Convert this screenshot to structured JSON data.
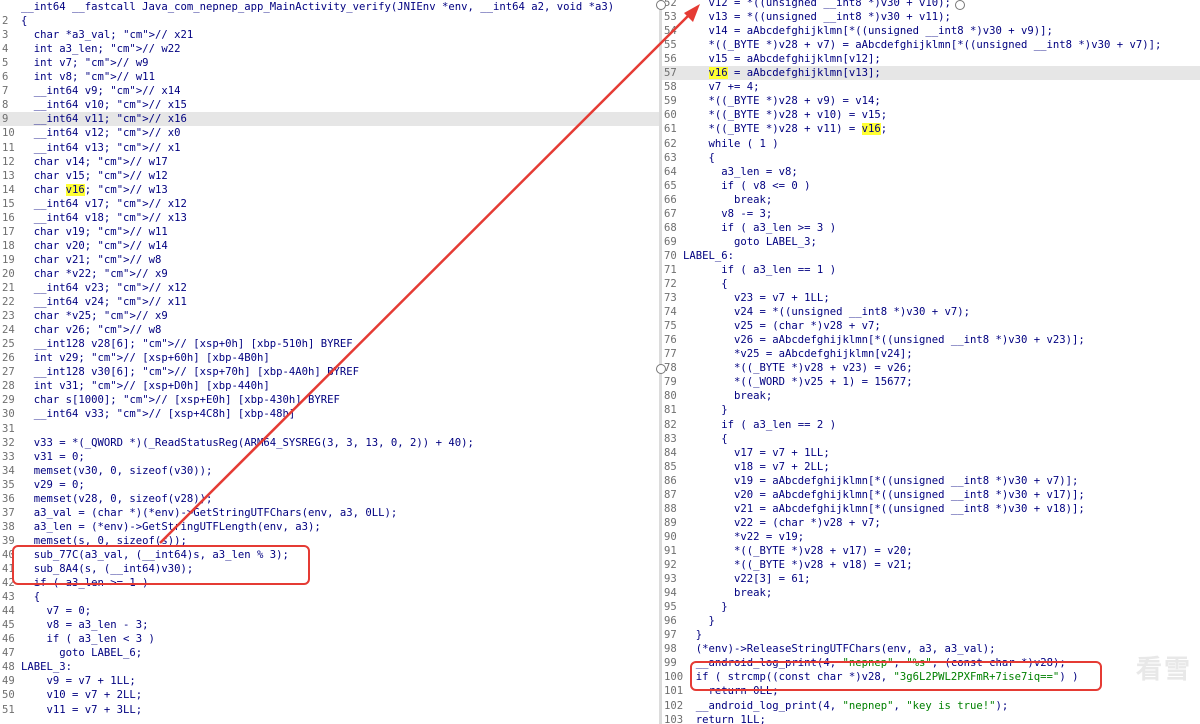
{
  "left_pane": {
    "lines": [
      {
        "n": "",
        "t": "__int64 __fastcall Java_com_nepnep_app_MainActivity_verify(JNIEnv *env, __int64 a2, void *a3)",
        "cls": ""
      },
      {
        "n": "2",
        "t": "{",
        "cls": ""
      },
      {
        "n": "3",
        "t": "  char *a3_val; // x21",
        "cls": ""
      },
      {
        "n": "4",
        "t": "  int a3_len; // w22",
        "cls": ""
      },
      {
        "n": "5",
        "t": "  int v7; // w9",
        "cls": ""
      },
      {
        "n": "6",
        "t": "  int v8; // w11",
        "cls": ""
      },
      {
        "n": "7",
        "t": "  __int64 v9; // x14",
        "cls": ""
      },
      {
        "n": "8",
        "t": "  __int64 v10; // x15",
        "cls": ""
      },
      {
        "n": "9",
        "t": "  __int64 v11; // x16",
        "cls": "hl"
      },
      {
        "n": "10",
        "t": "  __int64 v12; // x0",
        "cls": ""
      },
      {
        "n": "11",
        "t": "  __int64 v13; // x1",
        "cls": ""
      },
      {
        "n": "12",
        "t": "  char v14; // w17",
        "cls": ""
      },
      {
        "n": "13",
        "t": "  char v15; // w12",
        "cls": ""
      },
      {
        "n": "14",
        "t": "  char v16; // w13",
        "cls": ""
      },
      {
        "n": "15",
        "t": "  __int64 v17; // x12",
        "cls": ""
      },
      {
        "n": "16",
        "t": "  __int64 v18; // x13",
        "cls": ""
      },
      {
        "n": "17",
        "t": "  char v19; // w11",
        "cls": ""
      },
      {
        "n": "18",
        "t": "  char v20; // w14",
        "cls": ""
      },
      {
        "n": "19",
        "t": "  char v21; // w8",
        "cls": ""
      },
      {
        "n": "20",
        "t": "  char *v22; // x9",
        "cls": ""
      },
      {
        "n": "21",
        "t": "  __int64 v23; // x12",
        "cls": ""
      },
      {
        "n": "22",
        "t": "  __int64 v24; // x11",
        "cls": ""
      },
      {
        "n": "23",
        "t": "  char *v25; // x9",
        "cls": ""
      },
      {
        "n": "24",
        "t": "  char v26; // w8",
        "cls": ""
      },
      {
        "n": "25",
        "t": "  __int128 v28[6]; // [xsp+0h] [xbp-510h] BYREF",
        "cls": ""
      },
      {
        "n": "26",
        "t": "  int v29; // [xsp+60h] [xbp-4B0h]",
        "cls": ""
      },
      {
        "n": "27",
        "t": "  __int128 v30[6]; // [xsp+70h] [xbp-4A0h] BYREF",
        "cls": ""
      },
      {
        "n": "28",
        "t": "  int v31; // [xsp+D0h] [xbp-440h]",
        "cls": ""
      },
      {
        "n": "29",
        "t": "  char s[1000]; // [xsp+E0h] [xbp-430h] BYREF",
        "cls": ""
      },
      {
        "n": "30",
        "t": "  __int64 v33; // [xsp+4C8h] [xbp-48h]",
        "cls": ""
      },
      {
        "n": "31",
        "t": "",
        "cls": ""
      },
      {
        "n": "32",
        "t": "  v33 = *(_QWORD *)(_ReadStatusReg(ARM64_SYSREG(3, 3, 13, 0, 2)) + 40);",
        "cls": ""
      },
      {
        "n": "33",
        "t": "  v31 = 0;",
        "cls": ""
      },
      {
        "n": "34",
        "t": "  memset(v30, 0, sizeof(v30));",
        "cls": ""
      },
      {
        "n": "35",
        "t": "  v29 = 0;",
        "cls": ""
      },
      {
        "n": "36",
        "t": "  memset(v28, 0, sizeof(v28));",
        "cls": ""
      },
      {
        "n": "37",
        "t": "  a3_val = (char *)(*env)->GetStringUTFChars(env, a3, 0LL);",
        "cls": ""
      },
      {
        "n": "38",
        "t": "  a3_len = (*env)->GetStringUTFLength(env, a3);",
        "cls": ""
      },
      {
        "n": "39",
        "t": "  memset(s, 0, sizeof(s));",
        "cls": ""
      },
      {
        "n": "40",
        "t": "  sub_77C(a3_val, (__int64)s, a3_len % 3);",
        "cls": ""
      },
      {
        "n": "41",
        "t": "  sub_8A4(s, (__int64)v30);",
        "cls": ""
      },
      {
        "n": "42",
        "t": "  if ( a3_len >= 1 )",
        "cls": ""
      },
      {
        "n": "43",
        "t": "  {",
        "cls": ""
      },
      {
        "n": "44",
        "t": "    v7 = 0;",
        "cls": ""
      },
      {
        "n": "45",
        "t": "    v8 = a3_len - 3;",
        "cls": ""
      },
      {
        "n": "46",
        "t": "    if ( a3_len < 3 )",
        "cls": ""
      },
      {
        "n": "47",
        "t": "      goto LABEL_6;",
        "cls": ""
      },
      {
        "n": "48",
        "t": "LABEL_3:",
        "cls": ""
      },
      {
        "n": "49",
        "t": "    v9 = v7 + 1LL;",
        "cls": ""
      },
      {
        "n": "50",
        "t": "    v10 = v7 + 2LL;",
        "cls": ""
      },
      {
        "n": "51",
        "t": "    v11 = v7 + 3LL;",
        "cls": ""
      }
    ]
  },
  "right_pane": {
    "lines": [
      {
        "n": "52",
        "t": "    v12 = *((unsigned __int8 *)v30 + v10);",
        "cls": ""
      },
      {
        "n": "53",
        "t": "    v13 = *((unsigned __int8 *)v30 + v11);",
        "cls": ""
      },
      {
        "n": "54",
        "t": "    v14 = aAbcdefghijklmn[*((unsigned __int8 *)v30 + v9)];",
        "cls": ""
      },
      {
        "n": "55",
        "t": "    *((_BYTE *)v28 + v7) = aAbcdefghijklmn[*((unsigned __int8 *)v30 + v7)];",
        "cls": ""
      },
      {
        "n": "56",
        "t": "    v15 = aAbcdefghijklmn[v12];",
        "cls": ""
      },
      {
        "n": "57",
        "t": "    v16 = aAbcdefghijklmn[v13];",
        "cls": "hl"
      },
      {
        "n": "58",
        "t": "    v7 += 4;",
        "cls": ""
      },
      {
        "n": "59",
        "t": "    *((_BYTE *)v28 + v9) = v14;",
        "cls": ""
      },
      {
        "n": "60",
        "t": "    *((_BYTE *)v28 + v10) = v15;",
        "cls": ""
      },
      {
        "n": "61",
        "t": "    *((_BYTE *)v28 + v11) = v16;",
        "cls": ""
      },
      {
        "n": "62",
        "t": "    while ( 1 )",
        "cls": ""
      },
      {
        "n": "63",
        "t": "    {",
        "cls": ""
      },
      {
        "n": "64",
        "t": "      a3_len = v8;",
        "cls": ""
      },
      {
        "n": "65",
        "t": "      if ( v8 <= 0 )",
        "cls": ""
      },
      {
        "n": "66",
        "t": "        break;",
        "cls": ""
      },
      {
        "n": "67",
        "t": "      v8 -= 3;",
        "cls": ""
      },
      {
        "n": "68",
        "t": "      if ( a3_len >= 3 )",
        "cls": ""
      },
      {
        "n": "69",
        "t": "        goto LABEL_3;",
        "cls": ""
      },
      {
        "n": "70",
        "t": "LABEL_6:",
        "cls": ""
      },
      {
        "n": "71",
        "t": "      if ( a3_len == 1 )",
        "cls": ""
      },
      {
        "n": "72",
        "t": "      {",
        "cls": ""
      },
      {
        "n": "73",
        "t": "        v23 = v7 + 1LL;",
        "cls": ""
      },
      {
        "n": "74",
        "t": "        v24 = *((unsigned __int8 *)v30 + v7);",
        "cls": ""
      },
      {
        "n": "75",
        "t": "        v25 = (char *)v28 + v7;",
        "cls": ""
      },
      {
        "n": "76",
        "t": "        v26 = aAbcdefghijklmn[*((unsigned __int8 *)v30 + v23)];",
        "cls": ""
      },
      {
        "n": "77",
        "t": "        *v25 = aAbcdefghijklmn[v24];",
        "cls": ""
      },
      {
        "n": "78",
        "t": "        *((_BYTE *)v28 + v23) = v26;",
        "cls": ""
      },
      {
        "n": "79",
        "t": "        *((_WORD *)v25 + 1) = 15677;",
        "cls": ""
      },
      {
        "n": "80",
        "t": "        break;",
        "cls": ""
      },
      {
        "n": "81",
        "t": "      }",
        "cls": ""
      },
      {
        "n": "82",
        "t": "      if ( a3_len == 2 )",
        "cls": ""
      },
      {
        "n": "83",
        "t": "      {",
        "cls": ""
      },
      {
        "n": "84",
        "t": "        v17 = v7 + 1LL;",
        "cls": ""
      },
      {
        "n": "85",
        "t": "        v18 = v7 + 2LL;",
        "cls": ""
      },
      {
        "n": "86",
        "t": "        v19 = aAbcdefghijklmn[*((unsigned __int8 *)v30 + v7)];",
        "cls": ""
      },
      {
        "n": "87",
        "t": "        v20 = aAbcdefghijklmn[*((unsigned __int8 *)v30 + v17)];",
        "cls": ""
      },
      {
        "n": "88",
        "t": "        v21 = aAbcdefghijklmn[*((unsigned __int8 *)v30 + v18)];",
        "cls": ""
      },
      {
        "n": "89",
        "t": "        v22 = (char *)v28 + v7;",
        "cls": ""
      },
      {
        "n": "90",
        "t": "        *v22 = v19;",
        "cls": ""
      },
      {
        "n": "91",
        "t": "        *((_BYTE *)v28 + v17) = v20;",
        "cls": ""
      },
      {
        "n": "92",
        "t": "        *((_BYTE *)v28 + v18) = v21;",
        "cls": ""
      },
      {
        "n": "93",
        "t": "        v22[3] = 61;",
        "cls": ""
      },
      {
        "n": "94",
        "t": "        break;",
        "cls": ""
      },
      {
        "n": "95",
        "t": "      }",
        "cls": ""
      },
      {
        "n": "96",
        "t": "    }",
        "cls": ""
      },
      {
        "n": "97",
        "t": "  }",
        "cls": ""
      },
      {
        "n": "98",
        "t": "  (*env)->ReleaseStringUTFChars(env, a3, a3_val);",
        "cls": ""
      },
      {
        "n": "99",
        "t": "  __android_log_print(4, \"nepnep\", \"%s\", (const char *)v28);",
        "cls": ""
      },
      {
        "n": "100",
        "t": "  if ( strcmp((const char *)v28, \"3g6L2PWL2PXFmR+7ise7iq==\") )",
        "cls": ""
      },
      {
        "n": "101",
        "t": "    return 0LL;",
        "cls": ""
      },
      {
        "n": "102",
        "t": "  __android_log_print(4, \"nepnep\", \"key is true!\");",
        "cls": ""
      },
      {
        "n": "103",
        "t": "  return 1LL;",
        "cls": ""
      }
    ]
  },
  "watermark": "看雪",
  "colors": {
    "highlight_box": "#e53b34",
    "arrow": "#e53b34",
    "keyword": "#000080",
    "comment": "#a0a0a0",
    "string": "#008000",
    "yellow_highlight": "#ffff33"
  }
}
